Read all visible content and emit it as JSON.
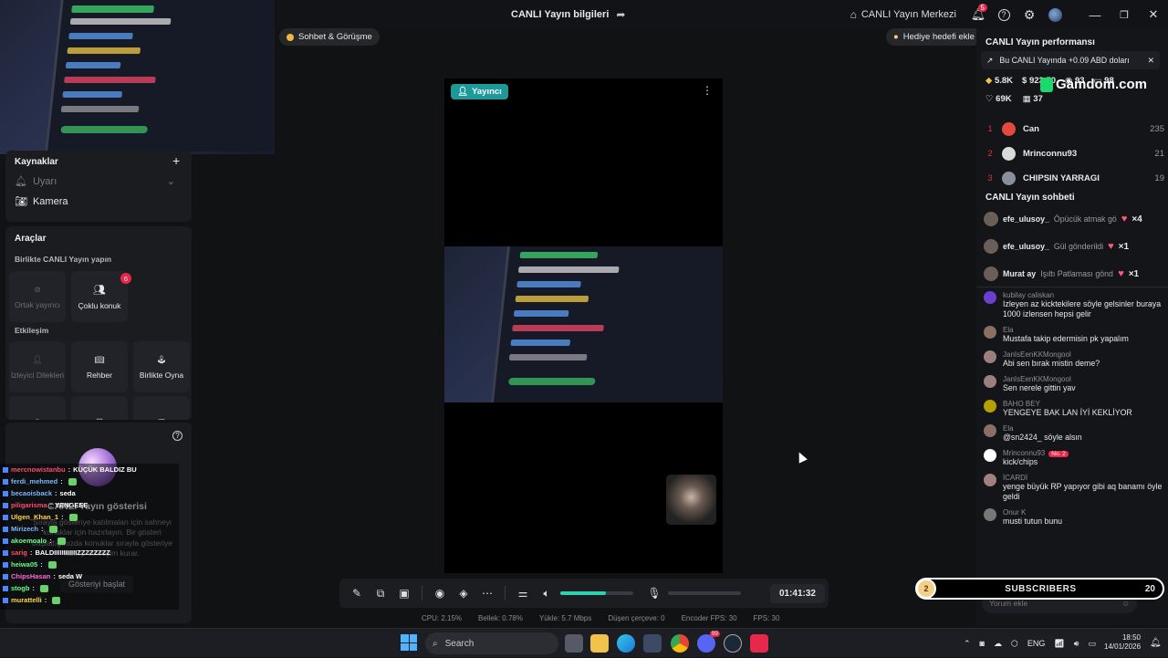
{
  "title_bar": {
    "stream_info_title": "CANLI Yayın bilgileri",
    "live_center_label": "CANLI Yayın Merkezi",
    "notification_count": "5"
  },
  "top_pills": {
    "chat_call": "Sohbet & Görüşme",
    "gift_goal": "Hediye hedefi ekle"
  },
  "left_panel": {
    "sources_title": "Kaynaklar",
    "sources_item_disabled": "Uyarı",
    "camera_label": "Kamera",
    "tools_title": "Araçlar",
    "together_live_title": "Birlikte CANLI Yayın yapın",
    "shared_host_label": "Ortak yayıncı",
    "multi_guest_label": "Çoklu konuk",
    "multi_guest_badge": "6",
    "interaction_title": "Etkileşim",
    "viewer_requests_label": "İzleyici Dilekleri",
    "guide_label": "Rehber",
    "play_together_label": "Birlikte Oyna",
    "show_title": "CANLI Yayın gösterisi",
    "show_desc_1": "Sırayla gösteriye katılmaları için sahneyi",
    "show_desc_2": "konuklar için hazırlayın. Bir gösteri",
    "show_desc_3": "başlattığınızda konuklar sırayla gösteriye",
    "show_desc_4": "katılıp etkileşim kurar.",
    "start_show_button": "Gösteriyi başlat"
  },
  "chat_overlay": {
    "lines": [
      {
        "user": "mercnowistanbu",
        "text": "KÜÇÜK BALDIZ BU",
        "user_color": "#ff4b6b"
      },
      {
        "user": "ferdi_mehmed",
        "text": "",
        "user_color": "#7ab7ff"
      },
      {
        "user": "becaoisback",
        "text": "seda",
        "user_color": "#7ab7ff"
      },
      {
        "user": "piligarisma",
        "text": "YENGEEE",
        "user_color": "#ff4b6b"
      },
      {
        "user": "Ulgen_Khan_1",
        "text": "",
        "user_color": "#ffd54a"
      },
      {
        "user": "Mirizech",
        "text": "",
        "user_color": "#7ab7ff"
      },
      {
        "user": "akoemoalo",
        "text": "",
        "user_color": "#66ff88"
      },
      {
        "user": "sarig",
        "text": "BALDIIIIIIIIIIIIZZZZZZZZ",
        "user_color": "#ff4b6b"
      },
      {
        "user": "heiwa05",
        "text": "",
        "user_color": "#66ff88"
      },
      {
        "user": "ChipsHasan",
        "text": "seda W",
        "user_color": "#ff6bd5"
      },
      {
        "user": "stogb",
        "text": "",
        "user_color": "#66ff88"
      },
      {
        "user": "murattelli",
        "text": "",
        "user_color": "#ffd54a"
      }
    ]
  },
  "preview": {
    "host_badge": "Yayıncı"
  },
  "controls": {
    "timer": "01:41:32",
    "volume_level": 0.62
  },
  "stats": {
    "cpu": "CPU:  2.15%",
    "memory": "Bellek:  0.78%",
    "upload": "Yükle:  5.7 Mbps",
    "dropped": "Düşen çerçeve:  0",
    "encoder_fps": "Encoder FPS:  30",
    "fps": "FPS:  30"
  },
  "right_panel": {
    "performance_title": "CANLI Yayın performansı",
    "earnings_note": "Bu CANLI Yayında +0.09 ABD doları",
    "stat_diamonds": "5.8K",
    "stat_coins": "923.50",
    "stat_viewers": "93",
    "stat_comments": "98",
    "stat_likes": "69K",
    "stat_gifts": "37",
    "gamdom_logo": "Gamdom.com",
    "ranking": [
      {
        "rank": "1",
        "name": "Can",
        "score": "235"
      },
      {
        "rank": "2",
        "name": "Mrinconnu93",
        "score": "21"
      },
      {
        "rank": "3",
        "name": "CHIPSIN YARRAGI",
        "score": "19"
      }
    ],
    "chat_title": "CANLI Yayın sohbeti",
    "gifts": [
      {
        "user": "efe_ulusoy_",
        "text": "Öpücük atmak gö",
        "count": "×4"
      },
      {
        "user": "efe_ulusoy_",
        "text": "Gül gönderildi",
        "count": "×1"
      },
      {
        "user": "Murat ay",
        "text": "Işıltı Patlaması göndé",
        "count": "×1"
      }
    ],
    "messages": [
      {
        "user": "kubilay caliskan",
        "text": "Izleyen az kicktekilere söyle gelsinler buraya 1000 izlensen hepsi gelir"
      },
      {
        "user": "Ela",
        "text": "Mustafa takip edermisin pk yapalım"
      },
      {
        "user": "JanIsEenKKMongool",
        "text": "Abi sen bırak mistin deme?"
      },
      {
        "user": "JanIsEenKKMongool",
        "text": "Sen nerele gittin yav"
      },
      {
        "user": "BAHO BEY",
        "text": "YENGEYE BAK LAN İYİ KEKLİYOR"
      },
      {
        "user": "Ela",
        "text": "@sn2424_ söyle alsın"
      },
      {
        "user": "Mrinconnu93",
        "text": "kick/chips",
        "badge": "No. 2"
      },
      {
        "user": "İCARDİ",
        "text": "yenge büyük RP yapıyor gibi aq banamı öyle geldi"
      },
      {
        "user": "Onur K",
        "text": "musti tutun bunu"
      }
    ],
    "comment_placeholder": "Yorum ekle",
    "subscribers_label": "SUBSCRIBERS",
    "subscribers_count": "20",
    "subscribers_goal_current": "2"
  },
  "taskbar": {
    "search_placeholder": "Search",
    "language": "ENG",
    "time": "18:50",
    "date": "14/01/2026",
    "discord_badge": "99"
  }
}
